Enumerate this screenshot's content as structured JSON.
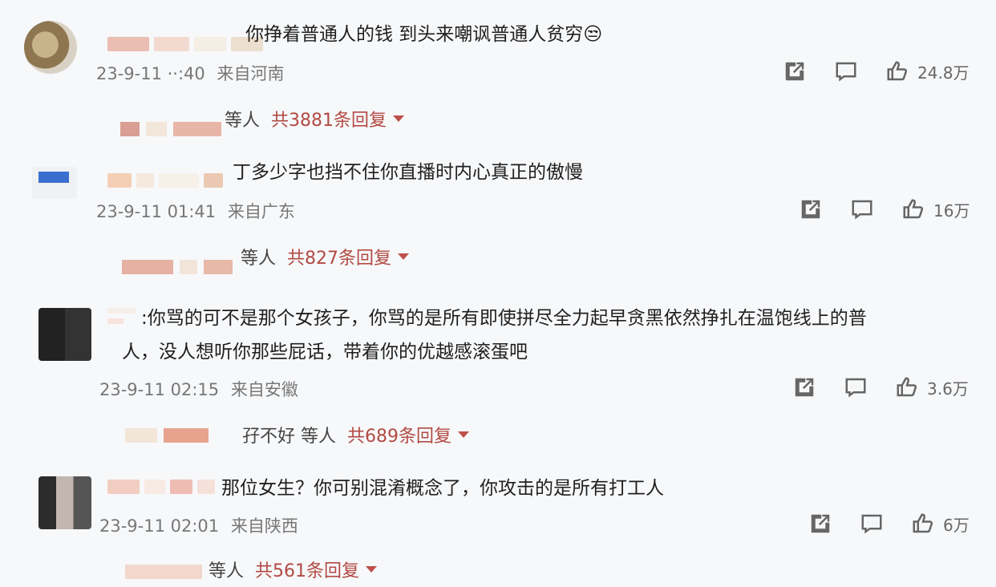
{
  "comments": [
    {
      "text": "你挣着普通人的钱 到头来嘲讽普通人贫穷😒",
      "meta_time": "23-9-11 ··:40",
      "meta_loc": "来自河南",
      "likes": "24.8万",
      "replies_who": "等人",
      "replies_link": "共3881条回复"
    },
    {
      "text": "丁多少字也挡不住你直播时内心真正的傲慢",
      "meta_time": "23-9-11 01:41",
      "meta_loc": "来自广东",
      "likes": "16万",
      "replies_who": "等人",
      "replies_link": "共827条回复"
    },
    {
      "text": ":你骂的可不是那个女孩子，你骂的是所有即使拼尽全力起早贪黑依然挣扎在温饱线上的普",
      "text2": "人，没人想听你那些屁话，带着你的优越感滚蛋吧",
      "meta_time": "23-9-11 02:15",
      "meta_loc": "来自安徽",
      "likes": "3.6万",
      "replies_who": "孖不好  等人",
      "replies_link": "共689条回复"
    },
    {
      "text": "那位女生？你可别混淆概念了，你攻击的是所有打工人",
      "meta_time": "23-9-11 02:01",
      "meta_loc": "来自陕西",
      "likes": "6万",
      "replies_who": "等人",
      "replies_link": "共561条回复"
    }
  ],
  "icons": {
    "share": "share-icon",
    "comment": "comment-icon",
    "like": "thumbs-up-icon"
  },
  "colors": {
    "reply_link": "#b24a43",
    "background": "#f7f8fa"
  }
}
